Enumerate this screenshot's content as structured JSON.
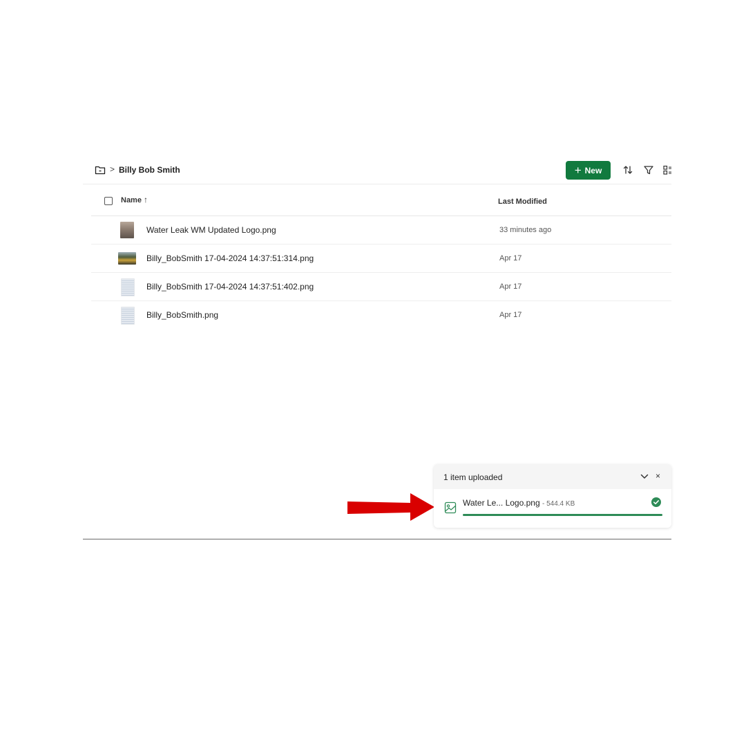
{
  "breadcrumb": {
    "separator": ">",
    "current": "Billy Bob Smith"
  },
  "toolbar": {
    "new_label": "New",
    "plus_glyph": "+",
    "icons": [
      "folder-icon",
      "sort-icon",
      "filter-icon",
      "view-options-icon"
    ]
  },
  "table": {
    "columns": {
      "name": "Name",
      "name_sort_glyph": "↑",
      "modified": "Last Modified"
    },
    "rows": [
      {
        "name": "Water Leak WM Updated Logo.png",
        "modified": "33 minutes ago"
      },
      {
        "name": "Billy_BobSmith 17-04-2024 14:37:51:314.png",
        "modified": "Apr 17"
      },
      {
        "name": "Billy_BobSmith 17-04-2024 14:37:51:402.png",
        "modified": "Apr 17"
      },
      {
        "name": "Billy_BobSmith.png",
        "modified": "Apr 17"
      }
    ]
  },
  "upload": {
    "title": "1 item uploaded",
    "close_glyph": "×",
    "item": {
      "name": "Water Le... Logo.png",
      "size": "- 544.4 KB",
      "progress": 1.0
    }
  },
  "colors": {
    "accent_green": "#117a3e",
    "progress_green": "#2e8b57",
    "annotation_red": "#d90000"
  }
}
